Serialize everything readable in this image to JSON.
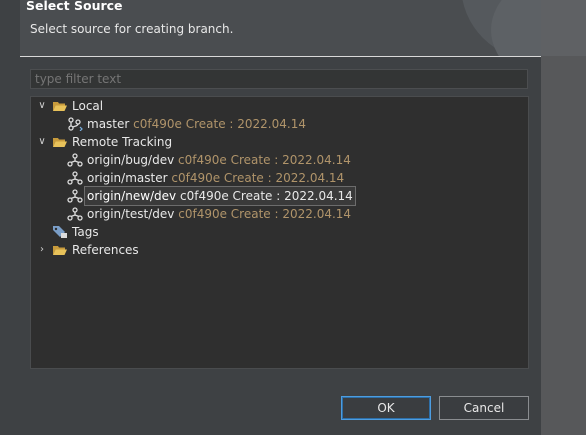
{
  "dialog": {
    "title": "Select Source",
    "subtitle": "Select source for creating branch."
  },
  "filter": {
    "placeholder": "type filter text",
    "value": ""
  },
  "tree": {
    "local": {
      "label": "Local",
      "children": [
        {
          "name": "master",
          "meta": "c0f490e Create : 2022.04.14"
        }
      ]
    },
    "remote": {
      "label": "Remote Tracking",
      "children": [
        {
          "name": "origin/bug/dev",
          "meta": "c0f490e Create : 2022.04.14"
        },
        {
          "name": "origin/master",
          "meta": "c0f490e Create : 2022.04.14"
        },
        {
          "name": "origin/new/dev",
          "meta": "c0f490e Create : 2022.04.14",
          "selected": true
        },
        {
          "name": "origin/test/dev",
          "meta": "c0f490e Create : 2022.04.14"
        }
      ]
    },
    "tags": {
      "label": "Tags"
    },
    "references": {
      "label": "References"
    }
  },
  "buttons": {
    "ok": "OK",
    "cancel": "Cancel"
  },
  "colors": {
    "meta": "#b0946a",
    "accent": "#4d9de0",
    "background": "#3e4144",
    "tree_bg": "#2f2f2f"
  }
}
